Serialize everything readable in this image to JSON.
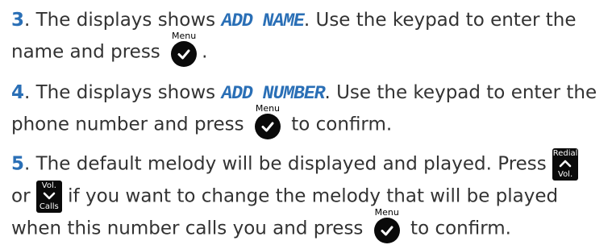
{
  "steps": [
    {
      "number": "3",
      "p1": ". The displays shows ",
      "display": "ADD NAME",
      "p2": ". Use the keypad to enter the",
      "p3": "name and press ",
      "menu_label": "Menu",
      "p4": "."
    },
    {
      "number": "4",
      "p1": ". The displays shows ",
      "display": "ADD NUMBER",
      "p2": ". Use the keypad to enter the",
      "p3": "phone number and press ",
      "menu_label": "Menu",
      "p4": " to confirm."
    },
    {
      "number": "5",
      "p1": ". The default melody will be displayed and played. Press ",
      "redial_top": "Redial",
      "redial_bottom": "Vol.",
      "p2": "or ",
      "vol_top": "Vol.",
      "vol_bottom": "Calls",
      "p3": " if you want to change the melody that will be played",
      "p4": "when this number calls you and press ",
      "menu_label": "Menu",
      "p5": " to confirm."
    }
  ]
}
